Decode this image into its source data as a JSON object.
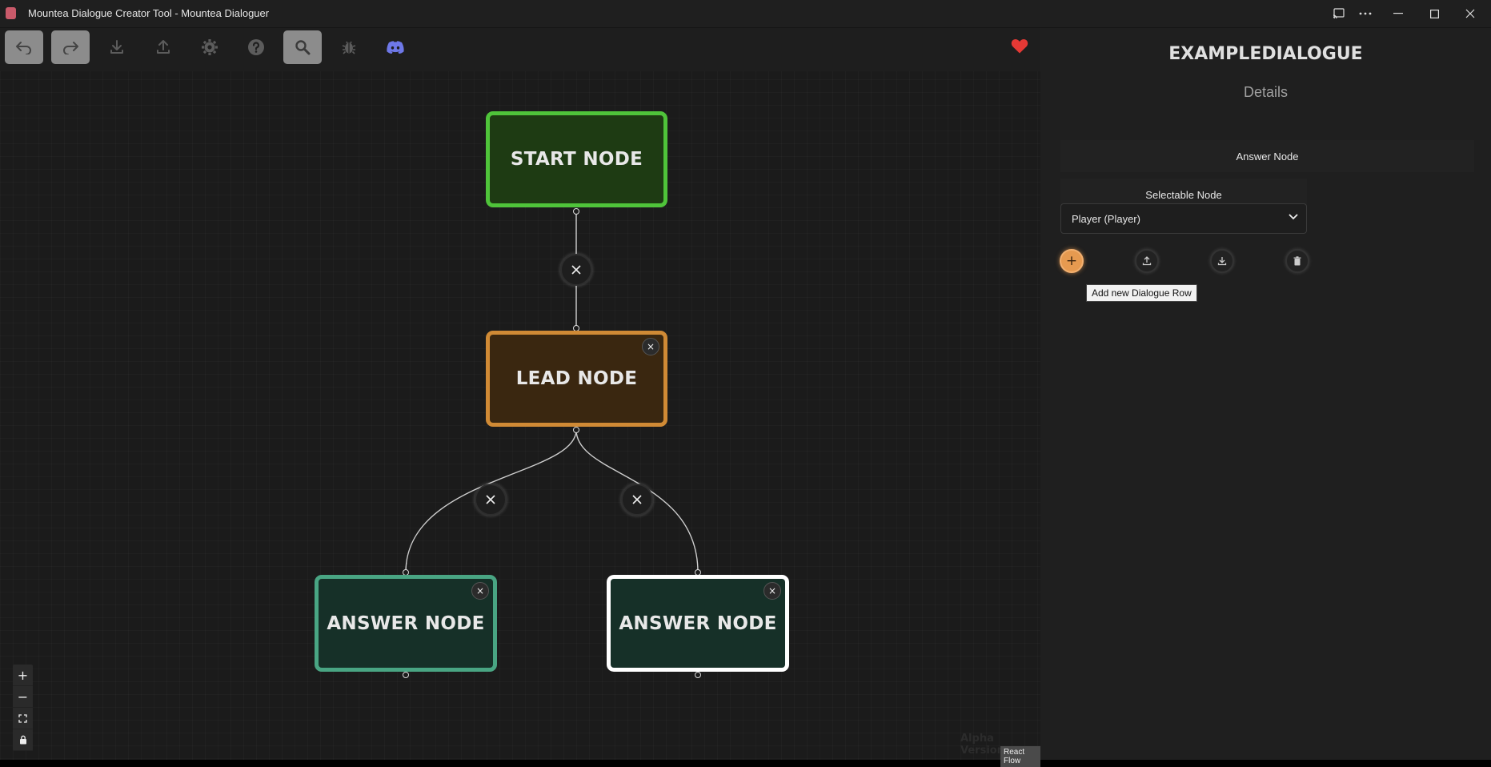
{
  "window": {
    "title": "Mountea Dialogue Creator Tool - Mountea Dialoguer"
  },
  "toolbar": {
    "buttons": [
      {
        "icon": "undo-icon",
        "active": true
      },
      {
        "icon": "redo-icon",
        "active": true
      },
      {
        "icon": "download-icon",
        "active": false
      },
      {
        "icon": "upload-icon",
        "active": false
      },
      {
        "icon": "gear-icon",
        "active": false
      },
      {
        "icon": "help-icon",
        "active": false
      },
      {
        "icon": "search-icon",
        "active": true
      },
      {
        "icon": "bug-icon",
        "active": false
      },
      {
        "icon": "discord-icon",
        "active": false
      }
    ],
    "heart_color": "#e53935"
  },
  "graph": {
    "start_node": {
      "label": "START NODE",
      "border": "#4fc43a",
      "fill": "#1e3b13"
    },
    "lead_node": {
      "label": "LEAD NODE",
      "border": "#d08a35",
      "fill": "#3a2710"
    },
    "answer_node_left": {
      "label": "ANSWER NODE",
      "border": "#49a583",
      "fill": "#163028"
    },
    "answer_node_right": {
      "label": "ANSWER NODE",
      "border": "#ffffff",
      "fill": "#163028"
    },
    "close_glyph": "×"
  },
  "zoom_controls": {
    "zoom_in": "+",
    "zoom_out": "−"
  },
  "footer": {
    "alpha": "Alpha Version",
    "react_flow": "React Flow"
  },
  "details": {
    "dialogue_name": "EXAMPLEDIALOGUE",
    "subtitle": "Details",
    "node_type": "Answer Node",
    "node_kind": "Selectable Node",
    "participant_value": "Player (Player)",
    "add_row_symbol": "+",
    "tooltip": "Add new Dialogue Row",
    "accent": "#e69a50"
  }
}
